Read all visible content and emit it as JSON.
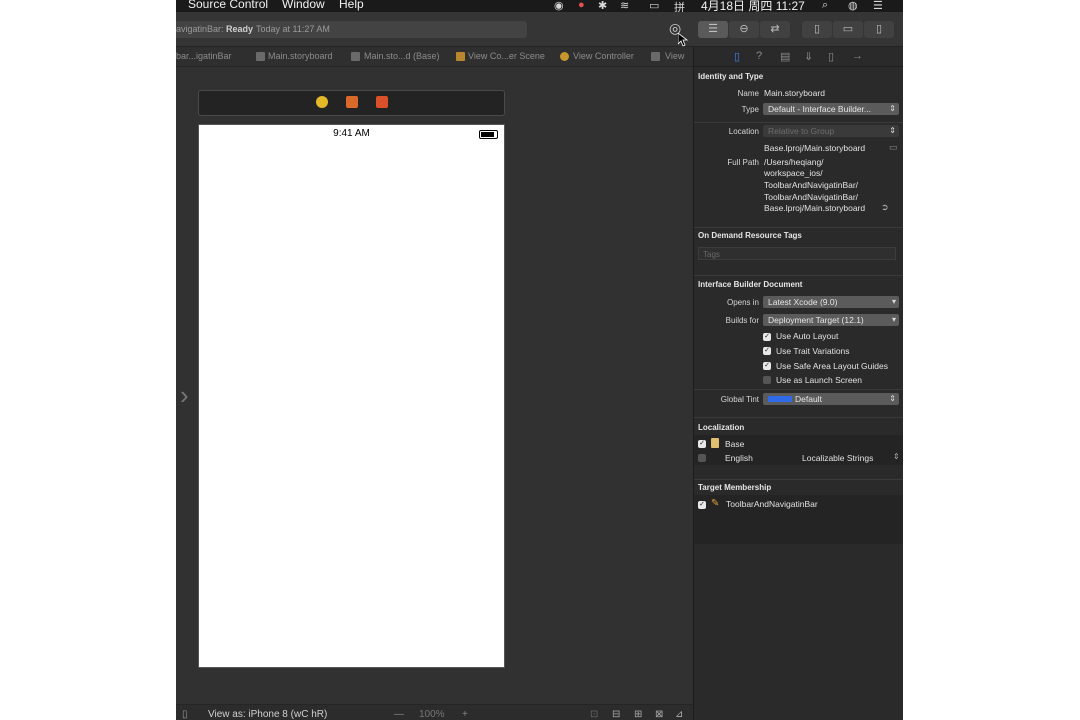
{
  "menubar": {
    "items": [
      "Source Control",
      "Window",
      "Help"
    ],
    "date_time": "4月18日 周四  11:27"
  },
  "toolbar": {
    "status_scheme": "avigatinBar:",
    "status_state": "Ready",
    "status_time": "Today at 11:27 AM"
  },
  "jumpbar": {
    "crumbs": [
      "bar...igatinBar",
      "Main.storyboard",
      "Main.sto...d (Base)",
      "View Co...er Scene",
      "View Controller",
      "View"
    ]
  },
  "canvas": {
    "phone_time": "9:41 AM"
  },
  "bottombar": {
    "view_as": "View as: iPhone 8 (wC hR)",
    "zoom": "100%"
  },
  "inspector": {
    "identity_title": "Identity and Type",
    "name_label": "Name",
    "name_value": "Main.storyboard",
    "type_label": "Type",
    "type_value": "Default - Interface Builder...",
    "location_label": "Location",
    "location_value": "Relative to Group",
    "location_path": "Base.lproj/Main.storyboard",
    "fullpath_label": "Full Path",
    "fullpath_lines": [
      "/Users/heqiang/",
      "workspace_ios/",
      "ToolbarAndNavigatinBar/",
      "ToolbarAndNavigatinBar/",
      "Base.lproj/Main.storyboard"
    ],
    "ondemand_title": "On Demand Resource Tags",
    "tags_placeholder": "Tags",
    "ib_title": "Interface Builder Document",
    "opens_in_label": "Opens in",
    "opens_in_value": "Latest Xcode (9.0)",
    "builds_for_label": "Builds for",
    "builds_for_value": "Deployment Target (12.1)",
    "checkboxes": [
      {
        "label": "Use Auto Layout",
        "checked": true
      },
      {
        "label": "Use Trait Variations",
        "checked": true
      },
      {
        "label": "Use Safe Area Layout Guides",
        "checked": true
      },
      {
        "label": "Use as Launch Screen",
        "checked": false
      }
    ],
    "global_tint_label": "Global Tint",
    "global_tint_value": "Default",
    "tint_color": "#2f6be8",
    "localization_title": "Localization",
    "loc_base": "Base",
    "loc_english": "English",
    "loc_english_type": "Localizable Strings",
    "target_title": "Target Membership",
    "target_name": "ToolbarAndNavigatinBar"
  }
}
